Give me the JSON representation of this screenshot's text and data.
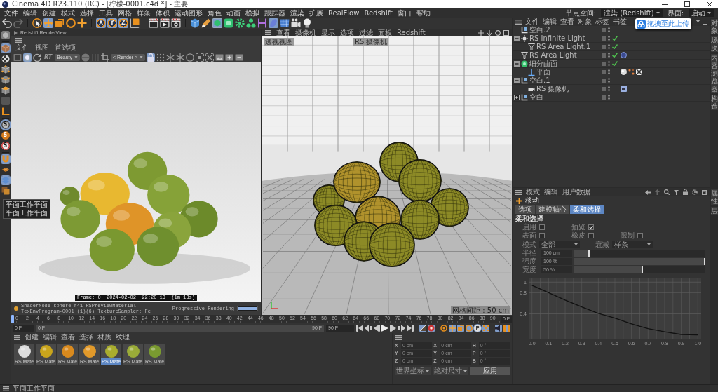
{
  "window": {
    "title": "Cinema 4D R23.110 (RC) - [柠檬-0001.c4d *] - 主要"
  },
  "menu_bar": {
    "items": [
      "文件",
      "编辑",
      "创建",
      "模式",
      "选择",
      "工具",
      "网格",
      "样条",
      "体积",
      "运动图形",
      "角色",
      "动画",
      "模拟",
      "跟踪器",
      "渲染",
      "扩展",
      "RealFlow",
      "Redshift",
      "窗口",
      "帮助"
    ],
    "node_space": {
      "label": "节点空间:",
      "value": "渲染 (Redshift)"
    },
    "layout": {
      "label": "界面:",
      "value": "启动"
    }
  },
  "toolbar": {
    "history": [
      {
        "disabled": false
      },
      {
        "disabled": true
      }
    ],
    "buttons": [
      {
        "selected": false
      },
      {
        "selected": true
      },
      {
        "selected": false
      },
      {
        "selected": false
      },
      {
        "selected": false
      },
      {
        "label": "X",
        "selected": true
      },
      {
        "label": "Y",
        "selected": true
      },
      {
        "label": "Z",
        "selected": true
      },
      {
        "selected": false
      },
      {
        "selected": false
      },
      {
        "selected": false
      },
      {
        "selected": false
      },
      {
        "selected": false
      },
      {
        "selected": false
      },
      {
        "selected": true
      },
      {
        "selected": false
      },
      {
        "selected": false
      },
      {
        "selected": false
      },
      {
        "selected": false
      },
      {
        "selected": true
      },
      {
        "selected": false
      },
      {
        "selected": false
      },
      {
        "selected": false
      }
    ]
  },
  "tool_strip": {
    "buttons": [
      {
        "selected": false
      },
      {
        "selected": true
      },
      {
        "selected": false
      },
      {
        "selected": false
      },
      {
        "selected": false
      },
      {
        "selected": false
      },
      {
        "selected": false
      },
      {
        "selected": false
      },
      {
        "label": "S",
        "selected": true
      },
      {
        "label": "S",
        "selected": false
      },
      {
        "label": "S",
        "selected": false
      },
      {
        "selected": true
      },
      {
        "selected": false
      },
      {
        "selected": true
      },
      {
        "selected": false
      }
    ],
    "tooltip": {
      "lines": [
        "平面工作平面",
        "平面工作平面"
      ]
    }
  },
  "render_view": {
    "title": "Redshift RenderView",
    "menu": [
      "文件",
      "视图",
      "首选项"
    ],
    "toolbar": [
      {
        "kind": "button",
        "selected": false
      },
      {
        "kind": "button",
        "selected": true
      },
      {
        "kind": "button",
        "selected": false
      },
      {
        "kind": "toggle",
        "label": "RT"
      },
      {
        "kind": "dropdown",
        "value": "Beauty"
      },
      {
        "kind": "button",
        "selected": false
      },
      {
        "kind": "button",
        "selected": false
      },
      {
        "kind": "button",
        "selected": false
      },
      {
        "kind": "dropdown",
        "value": "< Render >"
      },
      {
        "kind": "button",
        "selected": true
      },
      {
        "kind": "button",
        "selected": false
      },
      {
        "kind": "button",
        "selected": false
      },
      {
        "kind": "button",
        "selected": false
      },
      {
        "kind": "button",
        "selected": false
      },
      {
        "kind": "button",
        "selected": false
      },
      {
        "kind": "button",
        "selected": false
      },
      {
        "kind": "button",
        "selected": false
      },
      {
        "kind": "button",
        "selected": false
      },
      {
        "kind": "button",
        "selected": false
      }
    ],
    "caption": "Frame: 0  2024-02-02  22:20:13  (1m 13s)",
    "status": {
      "message": "ShaderNode sphere r41 RSPreviewMaterial TexEnvProgram-0001 (1)(6) TextureSampler: Fe",
      "mode": "Progressive Rendering",
      "progress": {
        "level": 1
      }
    }
  },
  "viewport": {
    "menu": [
      "查看",
      "摄像机",
      "显示",
      "选项",
      "过滤",
      "面板",
      "Redshift"
    ],
    "view_label": "透视视图",
    "camera_label": "RS 摄像机",
    "grid_label": "网格间距 : 50 cm"
  },
  "object_manager": {
    "menu": [
      "文件",
      "编辑",
      "查看",
      "对象",
      "标签",
      "书签"
    ],
    "objects": [
      {
        "name": "空白.2",
        "kind": "null"
      },
      {
        "name": "RS Infinite Light",
        "kind": "light",
        "enabled": true,
        "expanded": true,
        "children": [
          {
            "name": "RS Area Light.1",
            "kind": "area_light",
            "enabled": true
          }
        ]
      },
      {
        "name": "RS Area Light",
        "kind": "area_light",
        "enabled": true,
        "tags": [
          {
            "kind": "redshift"
          }
        ]
      },
      {
        "name": "细分曲面",
        "kind": "subdivision",
        "enabled": true,
        "expanded": true,
        "children": [
          {
            "name": "平面",
            "kind": "plane",
            "tags": [
              {
                "kind": "material"
              },
              {
                "kind": "dots"
              },
              {
                "kind": "checker"
              }
            ]
          }
        ]
      },
      {
        "name": "空白.1",
        "kind": "null",
        "expanded": true,
        "children": [
          {
            "name": "RS 摄像机",
            "kind": "camera",
            "tags": [
              {
                "kind": "camera"
              }
            ]
          }
        ]
      },
      {
        "name": "空白",
        "kind": "null",
        "expanded": false
      }
    ],
    "upload_popup": {
      "label": "拖拽至此上传"
    }
  },
  "attribute_manager": {
    "menu": [
      "模式",
      "编辑",
      "用户数据"
    ],
    "title": "移动",
    "tabs": [
      {
        "label": "选项",
        "selected": false
      },
      {
        "label": "建模轴心",
        "selected": false
      },
      {
        "label": "柔和选择",
        "selected": true
      }
    ],
    "section": "柔和选择",
    "checkbox_rows": [
      [
        {
          "label": "启用",
          "checked": false
        },
        {
          "label": "预览",
          "checked": true
        }
      ],
      [
        {
          "label": "表面",
          "checked": false
        },
        {
          "label": "橡皮",
          "checked": false
        },
        {
          "label": "限制",
          "checked": false
        }
      ]
    ],
    "dropdowns": [
      {
        "label": "模式",
        "value": "全部"
      },
      {
        "label": "衰减",
        "value": "样条"
      }
    ],
    "sliders": [
      {
        "label": "半径",
        "value": "100 cm",
        "level": 0.11
      },
      {
        "label": "强度",
        "value": "100 %",
        "level": 1
      },
      {
        "label": "宽度",
        "value": "50 %",
        "level": 0.52
      }
    ],
    "falloff_graph": {
      "chart_data": {
        "type": "line",
        "x": [
          0,
          0.1,
          0.2,
          0.3,
          0.4,
          0.5,
          0.6,
          0.7,
          0.8,
          0.9,
          1
        ],
        "series": [
          {
            "color": "#111111",
            "values": [
              0.94,
              0.8,
              0.66,
              0.53,
              0.41,
              0.32,
              0.21,
              0.12,
              0.06,
              0.01,
              0
            ]
          }
        ],
        "xlim": [
          -0.02,
          1.02
        ],
        "ylim": [
          -0.07,
          1.07
        ],
        "xticks": [
          {
            "value": 0,
            "label": "0.0"
          },
          0.1,
          0.2,
          0.3,
          0.4,
          0.5,
          0.6,
          0.7,
          0.8,
          0.9,
          {
            "value": 1,
            "label": "1.0"
          }
        ],
        "yticks": [
          {
            "value": 1,
            "label": "1"
          },
          0.8,
          0.4
        ],
        "grid": true
      }
    }
  },
  "side_tabs": {
    "top": [
      "对象",
      "场次",
      "内容浏览器",
      "构造"
    ],
    "bottom": [
      "属性",
      "层"
    ]
  },
  "timeline": {
    "ticks": [
      "0",
      "2",
      "4",
      "6",
      "8",
      "10",
      "12",
      "14",
      "16",
      "18",
      "20",
      "22",
      "24",
      "26",
      "28",
      "30",
      "32",
      "34",
      "36",
      "38",
      "40",
      "42",
      "44",
      "46",
      "48",
      "50",
      "52",
      "54",
      "56",
      "58",
      "60",
      "62",
      "64",
      "66",
      "68",
      "70",
      "72",
      "74",
      "76",
      "78",
      "80",
      "82",
      "84",
      "86",
      "88",
      "90"
    ],
    "playhead": {
      "level": 0
    },
    "current_frame": "0 F",
    "start": "0 F",
    "range_start": "0 F",
    "range_end": "90 F",
    "end": "90 F",
    "buttons": [
      {
        "selected": false
      },
      {
        "selected": false
      },
      {
        "selected": false
      },
      {
        "selected": false
      },
      {
        "selected": false
      },
      {
        "selected": false
      },
      {
        "selected": false
      },
      {
        "selected": true
      },
      {
        "selected": true
      },
      {
        "selected": false
      },
      {
        "selected": true
      },
      {
        "selected": true
      },
      {
        "selected": true
      },
      {
        "label": "P",
        "selected": true
      },
      {
        "selected": true
      },
      {
        "selected": true
      },
      {
        "selected": true
      }
    ]
  },
  "material_manager": {
    "menu": [
      "创建",
      "编辑",
      "查看",
      "选择",
      "材质",
      "纹理"
    ],
    "materials": [
      {
        "name": "RS Mate",
        "color": "#dcdcdc",
        "selected": false
      },
      {
        "name": "RS Mate",
        "color": "#c9a51c",
        "selected": false
      },
      {
        "name": "RS Mate",
        "color": "#d98a1e",
        "selected": false
      },
      {
        "name": "RS Mate",
        "color": "#e29a2a",
        "selected": false
      },
      {
        "name": "RS Mate",
        "color": "#a9ad2e",
        "selected": true
      },
      {
        "name": "RS Mate",
        "color": "#9aab38",
        "selected": false
      },
      {
        "name": "RS Mate",
        "color": "#7a9a30",
        "selected": false
      }
    ]
  },
  "coordinates": {
    "rows": [
      {
        "position_axis": "X",
        "position": "0 cm",
        "size_axis": "X",
        "size": "0 cm",
        "rotation_axis": "H",
        "rotation": "0 °"
      },
      {
        "position_axis": "Y",
        "position": "0 cm",
        "size_axis": "Y",
        "size": "0 cm",
        "rotation_axis": "P",
        "rotation": "0 °"
      },
      {
        "position_axis": "Z",
        "position": "0 cm",
        "size_axis": "Z",
        "size": "0 cm",
        "rotation_axis": "B",
        "rotation": "0 °"
      }
    ],
    "mode": "世界坐标",
    "size_mode": "绝对尺寸",
    "apply": "应用"
  },
  "status_bar": {
    "text": "平面工作平面"
  }
}
